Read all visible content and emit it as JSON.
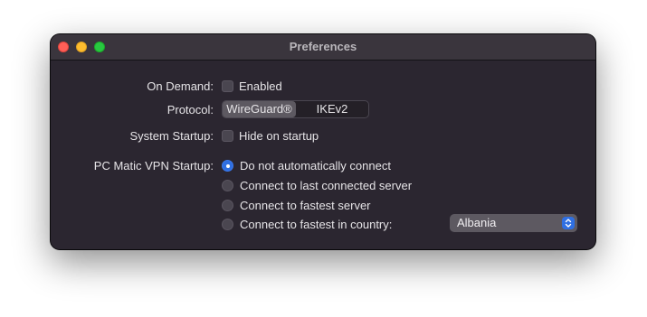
{
  "window": {
    "title": "Preferences"
  },
  "on_demand": {
    "label": "On Demand:",
    "checkbox_label": "Enabled",
    "checked": false
  },
  "protocol": {
    "label": "Protocol:",
    "options": [
      "WireGuard®",
      "IKEv2"
    ],
    "selected": "WireGuard®"
  },
  "system_startup": {
    "label": "System Startup:",
    "checkbox_label": "Hide on startup",
    "checked": false
  },
  "vpn_startup": {
    "label": "PC Matic VPN Startup:",
    "options": [
      "Do not automatically connect",
      "Connect to last connected server",
      "Connect to fastest server",
      "Connect to fastest in country:"
    ],
    "selected_index": 0,
    "country_select": {
      "value": "Albania"
    }
  },
  "colors": {
    "accent": "#2f6fe2",
    "window_bg": "#2b2630",
    "close": "#ff5f57",
    "minimize": "#febc2e",
    "zoom": "#28c840"
  },
  "icons": {
    "traffic_lights": [
      "close-icon",
      "minimize-icon",
      "zoom-icon"
    ],
    "select_arrows": "chevron-up-down-icon"
  }
}
